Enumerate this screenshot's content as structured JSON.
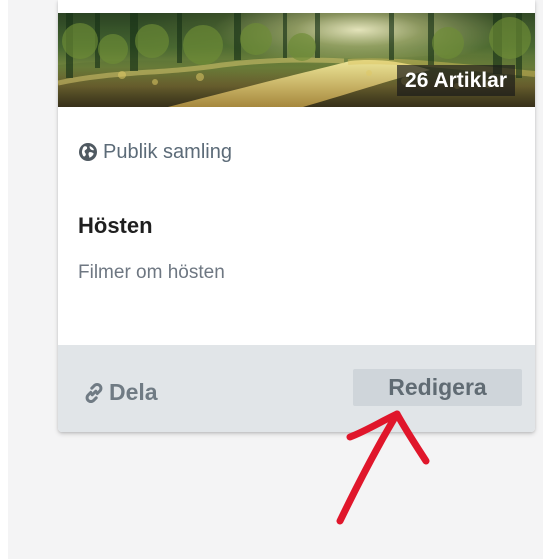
{
  "collection_card": {
    "article_count_label": "26 Artiklar",
    "visibility": {
      "icon": "globe-icon",
      "label": "Publik samling"
    },
    "title": "Hösten",
    "description": "Filmer om hösten",
    "footer": {
      "share": {
        "icon": "link-icon",
        "label": "Dela"
      },
      "edit_button_label": "Redigera"
    }
  },
  "colors": {
    "page_background": "#f4f4f5",
    "card_background": "#ffffff",
    "footer_background": "#e1e5e8",
    "edit_button_background": "#cfd5da",
    "annotation_arrow": "#e0162b"
  }
}
